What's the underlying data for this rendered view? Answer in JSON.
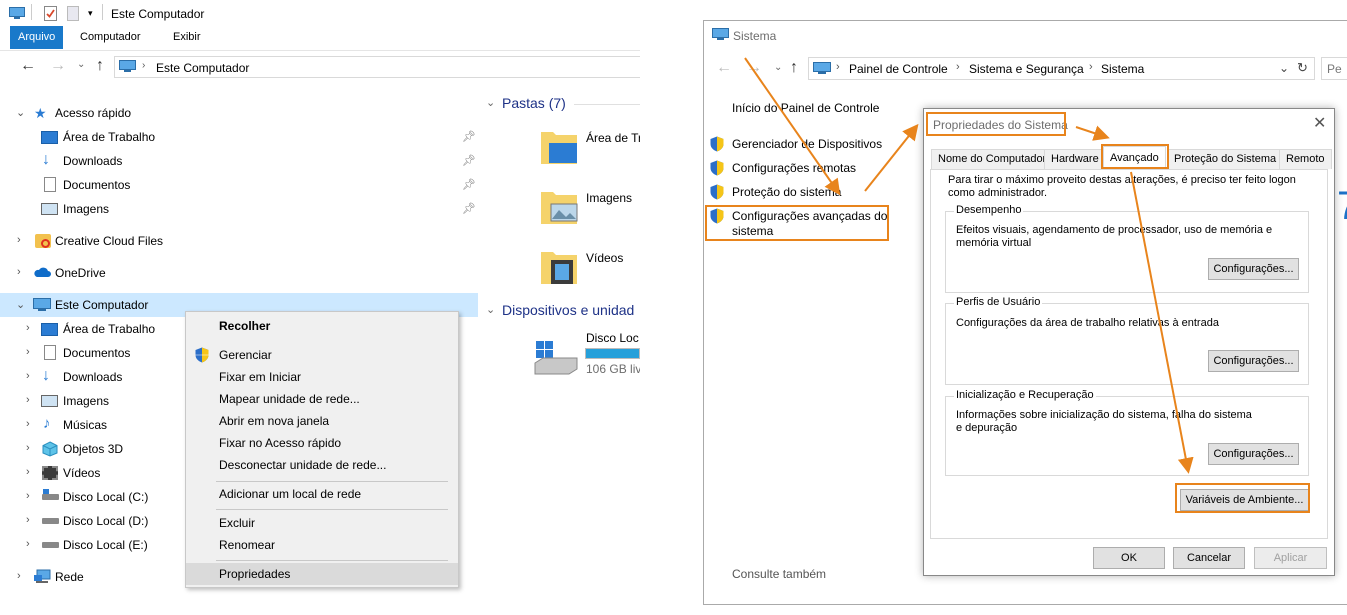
{
  "explorer": {
    "title": "Este Computador",
    "ribbon_tabs": [
      "Arquivo",
      "Computador",
      "Exibir"
    ],
    "address": "Este Computador",
    "nav_tree": [
      {
        "label": "Acesso rápido",
        "icon": "star-icon",
        "expanded": true
      },
      {
        "label": "Área de Trabalho",
        "icon": "desktop-icon",
        "pinned": true
      },
      {
        "label": "Downloads",
        "icon": "download-icon",
        "pinned": true
      },
      {
        "label": "Documentos",
        "icon": "document-icon",
        "pinned": true
      },
      {
        "label": "Imagens",
        "icon": "image-icon",
        "pinned": true
      },
      {
        "label": "Creative Cloud Files",
        "icon": "creative-cloud-icon"
      },
      {
        "label": "OneDrive",
        "icon": "cloud-icon"
      },
      {
        "label": "Este Computador",
        "icon": "computer-icon",
        "expanded": true,
        "selected": true
      },
      {
        "label": "Área de Trabalho",
        "icon": "desktop-icon"
      },
      {
        "label": "Documentos",
        "icon": "document-icon"
      },
      {
        "label": "Downloads",
        "icon": "download-icon"
      },
      {
        "label": "Imagens",
        "icon": "image-icon"
      },
      {
        "label": "Músicas",
        "icon": "music-icon"
      },
      {
        "label": "Objetos 3D",
        "icon": "cube-icon"
      },
      {
        "label": "Vídeos",
        "icon": "video-icon"
      },
      {
        "label": "Disco Local (C:)",
        "icon": "drive-icon"
      },
      {
        "label": "Disco Local (D:)",
        "icon": "drive-icon"
      },
      {
        "label": "Disco Local (E:)",
        "icon": "drive-icon"
      },
      {
        "label": "Rede",
        "icon": "network-icon"
      }
    ],
    "context_menu": {
      "header": "Recolher",
      "group1": [
        "Gerenciar",
        "Fixar em Iniciar",
        "Mapear unidade de rede...",
        "Abrir em nova janela",
        "Fixar no Acesso rápido",
        "Desconectar unidade de rede..."
      ],
      "group2": [
        "Adicionar um local de rede"
      ],
      "group3": [
        "Excluir",
        "Renomear"
      ],
      "group4": [
        "Propriedades"
      ]
    },
    "content": {
      "folders_header": "Pastas (7)",
      "folders": [
        "Área de Tr",
        "Imagens",
        "Vídeos"
      ],
      "devices_header": "Dispositivos e unidad",
      "drive_name": "Disco Loc",
      "drive_size": "106 GB liv",
      "drive_fill_percent": 100
    }
  },
  "sistema": {
    "title": "Sistema",
    "breadcrumb": [
      "Painel de Controle",
      "Sistema e Segurança",
      "Sistema"
    ],
    "search_placeholder": "Pe",
    "home_link": "Início do Painel de Controle",
    "links": [
      "Gerenciador de Dispositivos",
      "Configurações remotas",
      "Proteção do sistema",
      "Configurações avançadas do",
      "sistema"
    ],
    "see_also": "Consulte também"
  },
  "dialog": {
    "title": "Propriedades do Sistema",
    "tabs": [
      "Nome do Computador",
      "Hardware",
      "Avançado",
      "Proteção do Sistema",
      "Remoto"
    ],
    "intro": "Para tirar o máximo proveito destas alterações, é preciso ter feito logon como administrador.",
    "groups": [
      {
        "title": "Desempenho",
        "desc": "Efeitos visuais, agendamento de processador, uso de memória e memória virtual",
        "button": "Configurações..."
      },
      {
        "title": "Perfis de Usuário",
        "desc": "Configurações da área de trabalho relativas à entrada",
        "button": "Configurações..."
      },
      {
        "title": "Inicialização e Recuperação",
        "desc": "Informações sobre inicialização do sistema, falha do sistema e depuração",
        "button": "Configurações..."
      }
    ],
    "env_button": "Variáveis de Ambiente...",
    "ok": "OK",
    "cancel": "Cancelar",
    "apply": "Aplicar"
  },
  "colors": {
    "accent": "#1979ca",
    "highlight": "#e8841c",
    "selection": "#cce8ff",
    "group_header": "#1e3287"
  }
}
